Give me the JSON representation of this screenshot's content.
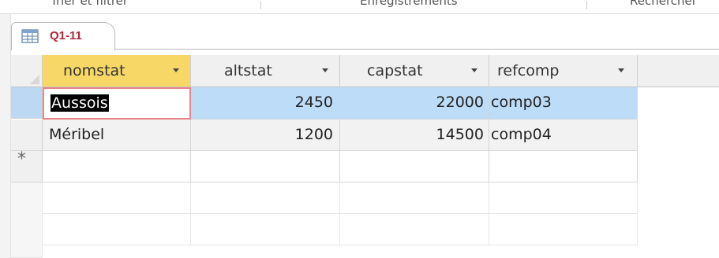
{
  "ribbon": {
    "groups": [
      "Trier et filtrer",
      "Enregistrements",
      "Rechercher"
    ]
  },
  "tab": {
    "icon": "query-datasheet-icon",
    "label": "Q1-11"
  },
  "table": {
    "columns": [
      "nomstat",
      "altstat",
      "capstat",
      "refcomp"
    ],
    "selected_column": "nomstat",
    "rows": [
      {
        "nomstat": "Aussois",
        "altstat": "2450",
        "capstat": "22000",
        "refcomp": "comp03"
      },
      {
        "nomstat": "Méribel",
        "altstat": "1200",
        "capstat": "14500",
        "refcomp": "comp04"
      }
    ],
    "new_record_marker": "*"
  },
  "colors": {
    "selected_header": "#f7d867",
    "current_row": "#bcdcf7",
    "edit_border": "#e8858b",
    "tab_label": "#b0283c"
  }
}
